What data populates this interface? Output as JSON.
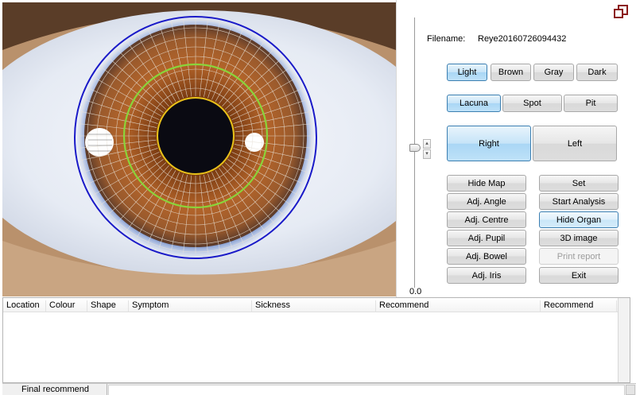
{
  "file": {
    "label": "Filename:",
    "value": "Reye20160726094432"
  },
  "slider": {
    "value": "0.0"
  },
  "color_buttons": [
    {
      "label": "Light",
      "active": true
    },
    {
      "label": "Brown",
      "active": false
    },
    {
      "label": "Gray",
      "active": false
    },
    {
      "label": "Dark",
      "active": false
    }
  ],
  "mark_buttons": [
    {
      "label": "Lacuna",
      "active": true
    },
    {
      "label": "Spot",
      "active": false
    },
    {
      "label": "Pit",
      "active": false
    }
  ],
  "eye_buttons": [
    {
      "label": "Right",
      "active": true
    },
    {
      "label": "Left",
      "active": false
    }
  ],
  "left_actions": [
    "Hide Map",
    "Adj. Angle",
    "Adj. Centre",
    "Adj. Pupil",
    "Adj. Bowel",
    "Adj. Iris"
  ],
  "right_actions": [
    "Set",
    "Start Analysis",
    "Hide Organ",
    "3D image",
    "Print report",
    "Exit"
  ],
  "table": {
    "columns": [
      "Location",
      "Colour",
      "Shape",
      "Symptom",
      "Sickness",
      "Recommend",
      "Recommend"
    ]
  },
  "footer": {
    "tab_label": "Final recommend"
  },
  "colors": {
    "accent": "#3c7fb1",
    "active_fill": "#bfe2f8",
    "iris_outer_ring": "#1a1ac8",
    "iris_inner_ring": "#8ad43a",
    "pupil_ring": "#e8c21a"
  }
}
